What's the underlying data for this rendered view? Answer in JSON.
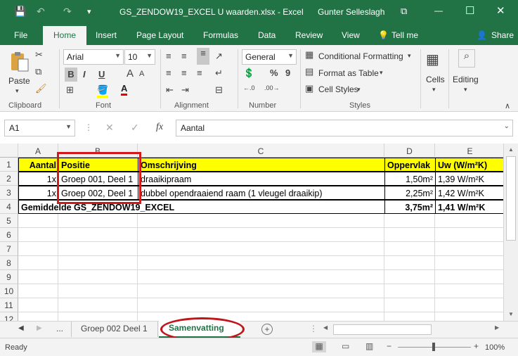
{
  "window": {
    "title": "GS_ZENDOW19_EXCEL U waarden.xlsx - Excel",
    "user": "Gunter Selleslagh",
    "qa_save": "💾",
    "qa_undo": "↶",
    "qa_redo": "↷",
    "qa_more": "▾",
    "win_restore": "⧉",
    "win_min": "—",
    "win_max": "☐",
    "win_close": "✕"
  },
  "ribbon_tabs": [
    "File",
    "Home",
    "Insert",
    "Page Layout",
    "Formulas",
    "Data",
    "Review",
    "View",
    "Tell me",
    "Share"
  ],
  "ribbon": {
    "clipboard": {
      "paste": "Paste",
      "label": "Clipboard"
    },
    "font": {
      "name": "Arial",
      "size": "10",
      "bold": "B",
      "italic": "I",
      "underline": "U",
      "label": "Font"
    },
    "alignment": {
      "label": "Alignment"
    },
    "number": {
      "format": "General",
      "percent": "%",
      "comma": "9",
      "label": "Number"
    },
    "styles": {
      "conditional": "Conditional Formatting",
      "table": "Format as Table",
      "cell": "Cell Styles",
      "label": "Styles"
    },
    "cells": "Cells",
    "editing": "Editing"
  },
  "formula_bar": {
    "namebox": "A1",
    "fx": "fx",
    "value": "Aantal"
  },
  "columns": [
    "A",
    "B",
    "C",
    "D",
    "E"
  ],
  "rows": [
    "1",
    "2",
    "3",
    "4",
    "5",
    "6",
    "7",
    "8",
    "9",
    "10",
    "11",
    "12"
  ],
  "cells": {
    "r1": [
      "Aantal",
      "Positie",
      "Omschrijving",
      "Oppervlak",
      "Uw (W/m²K)"
    ],
    "r2": [
      "1x",
      "Groep 001, Deel 1",
      "draaikipraam",
      "1,50m²",
      "1,39 W/m²K"
    ],
    "r3": [
      "1x",
      "Groep 002, Deel 1",
      "dubbel opendraaiend raam (1 vleugel draaikip)",
      "2,25m²",
      "1,42 W/m²K"
    ],
    "r4": [
      "Gemiddelde GS_ZENDOW19_EXCEL",
      "3,75m²",
      "1,41 W/m²K"
    ]
  },
  "sheets": {
    "ellipsis": "...",
    "tab1": "Groep 002 Deel 1",
    "tab2": "Samenvatting",
    "add": "+"
  },
  "status": {
    "ready": "Ready",
    "zoom": "100%"
  },
  "colors": {
    "excel_green": "#217346",
    "header_yellow": "#ffff00",
    "highlight_red": "#d11a1a"
  }
}
